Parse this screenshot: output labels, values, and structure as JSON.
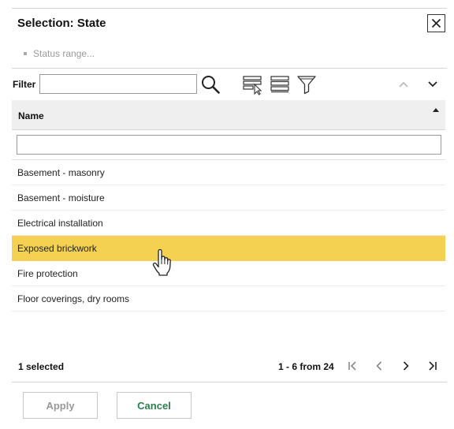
{
  "dialog": {
    "title": "Selection: State",
    "status_range": "Status range..."
  },
  "filter": {
    "label": "Filter",
    "value": ""
  },
  "grid": {
    "column_header": "Name",
    "column_filter_value": "",
    "rows": [
      "Basement - masonry",
      "Basement - moisture",
      "Electrical installation",
      "Exposed brickwork",
      "Fire protection",
      "Floor coverings, dry rooms"
    ],
    "selected_row": "Exposed brickwork",
    "selection_color": "#f4d151"
  },
  "footer": {
    "selected_count": "1 selected",
    "pager_range": "1 - 6 from 24"
  },
  "buttons": {
    "apply": "Apply",
    "cancel": "Cancel"
  },
  "icons": {
    "close": "close-icon",
    "search": "search-icon",
    "select-column": "select-column-icon",
    "list-view": "list-view-icon",
    "funnel": "funnel-filter-icon",
    "collapse": "chevron-up-icon",
    "expand": "chevron-down-icon",
    "first-page": "first-page-icon",
    "prev-page": "chevron-left-icon",
    "next-page": "chevron-right-icon",
    "last-page": "last-page-icon",
    "cursor": "hand-pointer-icon"
  }
}
